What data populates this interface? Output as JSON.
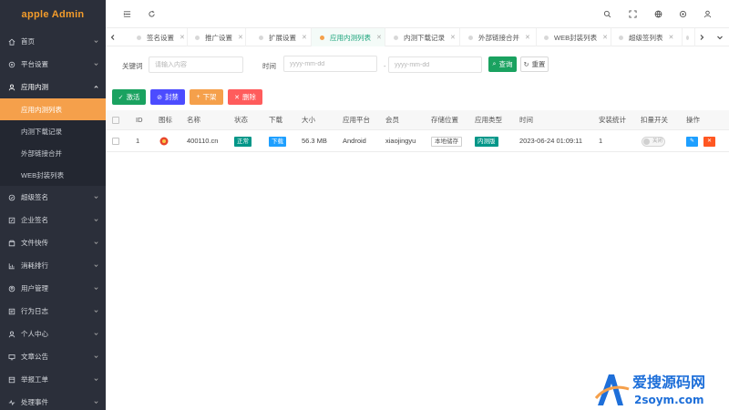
{
  "app": {
    "title": "apple Admin"
  },
  "sidebar": {
    "items": [
      {
        "label": "首页",
        "icon": "home-icon"
      },
      {
        "label": "平台设置",
        "icon": "gear-icon"
      },
      {
        "label": "应用内测",
        "icon": "user-icon",
        "open": true
      },
      {
        "label": "超级签名",
        "icon": "shield-icon"
      },
      {
        "label": "企业签名",
        "icon": "edit-icon"
      },
      {
        "label": "文件快传",
        "icon": "file-icon"
      },
      {
        "label": "消耗排行",
        "icon": "chart-icon"
      },
      {
        "label": "用户管理",
        "icon": "users-icon"
      },
      {
        "label": "行为日志",
        "icon": "log-icon"
      },
      {
        "label": "个人中心",
        "icon": "person-icon"
      },
      {
        "label": "文章公告",
        "icon": "monitor-icon"
      },
      {
        "label": "举报工单",
        "icon": "ticket-icon"
      },
      {
        "label": "处理事件",
        "icon": "pulse-icon"
      }
    ],
    "sub_items": [
      {
        "label": "应用内测列表",
        "active": true
      },
      {
        "label": "内测下载记录"
      },
      {
        "label": "外部链接合并"
      },
      {
        "label": "WEB封装列表"
      }
    ]
  },
  "tabs": [
    {
      "label": "签名设置"
    },
    {
      "label": "推广设置"
    },
    {
      "label": "扩展设置"
    },
    {
      "label": "应用内测列表",
      "active": true
    },
    {
      "label": "内测下载记录"
    },
    {
      "label": "外部链接合并"
    },
    {
      "label": "WEB封装列表"
    },
    {
      "label": "超级签列表"
    }
  ],
  "search": {
    "keyword_label": "关键词",
    "keyword_placeholder": "请输入内容",
    "time_label": "时间",
    "date_start_placeholder": "yyyy-mm-dd",
    "date_sep": "-",
    "date_end_placeholder": "yyyy-mm-dd",
    "query_label": "查询",
    "reset_label": "重置"
  },
  "toolbar": {
    "activate_label": "激活",
    "ban_label": "封禁",
    "down_label": "下架",
    "delete_label": "删除"
  },
  "table": {
    "headers": [
      "ID",
      "图标",
      "名称",
      "状态",
      "下载",
      "大小",
      "应用平台",
      "会员",
      "存储位置",
      "应用类型",
      "时间",
      "安装统计",
      "扣量开关",
      "操作"
    ],
    "rows": [
      {
        "id": "1",
        "name": "400110.cn",
        "status": "正常",
        "download": "下载",
        "size": "56.3 MB",
        "platform": "Android",
        "member": "xiaojingyu",
        "storage": "本地储存",
        "type": "内测版",
        "time": "2023-06-24 01:09:11",
        "installs": "1",
        "switch_label": "关闭"
      }
    ]
  },
  "watermark": {
    "line1": "爱搜源码网",
    "line2": "2soym.com"
  },
  "colors": {
    "sidebar_bg": "#2b2f3a",
    "brand": "#f39c2b",
    "active_orange": "#f5a04b",
    "green": "#1aa260",
    "teal": "#009688",
    "blue": "#1e9fff",
    "purple": "#4c4cff",
    "red": "#ff5c5c"
  }
}
